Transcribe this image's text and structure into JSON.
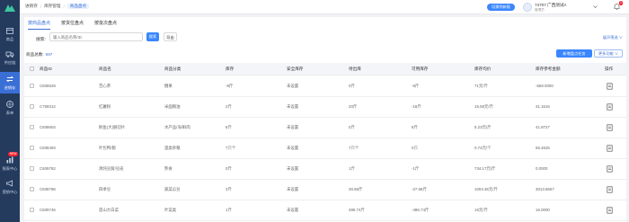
{
  "sidebar": {
    "items": [
      {
        "label": "商品",
        "icon": "box-icon"
      },
      {
        "label": "供应链",
        "icon": "truck-icon"
      },
      {
        "label": "进销存",
        "icon": "swap-icon",
        "active": true
      },
      {
        "label": "表单",
        "icon": "grid-icon"
      },
      {
        "label": "报表中心",
        "icon": "chart-icon"
      },
      {
        "label": "营销中心",
        "icon": "megaphone-icon"
      }
    ],
    "badge": "NEW"
  },
  "topbar": {
    "breadcrumb": [
      "进销存",
      "库存管理",
      "商品盘点"
    ],
    "action_button": "切换到新版",
    "store_name": "74707 广西测试A",
    "store_role": "管理员",
    "bell_count": "1"
  },
  "tabs": [
    "按商品盘点",
    "按货位盘点",
    "按批次盘点"
  ],
  "filter": {
    "label": "搜索:",
    "placeholder": "输入商品名称/ID",
    "search_label": "搜索",
    "export_label": "导出",
    "more_label": "展开筛选 ∨"
  },
  "summary": {
    "label": "商品总数:",
    "count": "697"
  },
  "actions": {
    "primary": "新增盘点任务",
    "secondary": "更多功能 ∨"
  },
  "table": {
    "columns": [
      "商品ID",
      "商品名",
      "商品分类",
      "库存",
      "安全库存",
      "待出库",
      "可用库存",
      "库存均价",
      "库存参考金额",
      "操作"
    ],
    "rows": [
      {
        "id": "C608629",
        "name": "苦心茶",
        "category": "糖果",
        "stock": "-8斤",
        "safety": "未设置",
        "out": "0斤",
        "avail": "-8斤",
        "price": "71元/斤",
        "amount": "-568.0000"
      },
      {
        "id": "C769312",
        "name": "红薯粉",
        "category": "米面粮油",
        "stock": "2斤",
        "safety": "未设置",
        "out": "20斤",
        "avail": "-18斤",
        "price": "15.58元/斤",
        "amount": "31.1616"
      },
      {
        "id": "C608604",
        "name": "鲜鱼(大)鲢切片",
        "category": "水产品/海/鲜肉",
        "stock": "8斤",
        "safety": "未设置",
        "out": "0斤",
        "avail": "8斤",
        "price": "5.23元/斤",
        "amount": "41.8727"
      },
      {
        "id": "C608493",
        "name": "叶包鸭/鹅",
        "category": "蛋类杂粮",
        "stock": "7只个",
        "safety": "未设置",
        "out": "7只个",
        "avail": "0只",
        "price": "0.74元/个",
        "amount": "55.4625"
      },
      {
        "id": "C609782",
        "name": "清炖豆腐/豆皮",
        "category": "熟食",
        "stock": "0斤",
        "safety": "未设置",
        "out": "1斤",
        "avail": "-1斤",
        "price": "734.17元/斤",
        "amount": "0.0000"
      },
      {
        "id": "C608786",
        "name": "四季豆",
        "category": "蔬菜瓜豆",
        "stock": "3斤",
        "safety": "未设置",
        "out": "30.68斤",
        "avail": "-27.68斤",
        "price": "1004.36元/斤",
        "amount": "3013.6667"
      },
      {
        "id": "C609746",
        "name": "莲山大白菜",
        "category": "叶菜类",
        "stock": "1斤",
        "safety": "未设置",
        "out": "486.74斤",
        "avail": "-486.74斤",
        "price": "16元/斤",
        "amount": "16.0000"
      }
    ]
  },
  "colors": {
    "sidebar": "#243b5e",
    "accent": "#3a86ff",
    "active": "#3a6fd6"
  }
}
